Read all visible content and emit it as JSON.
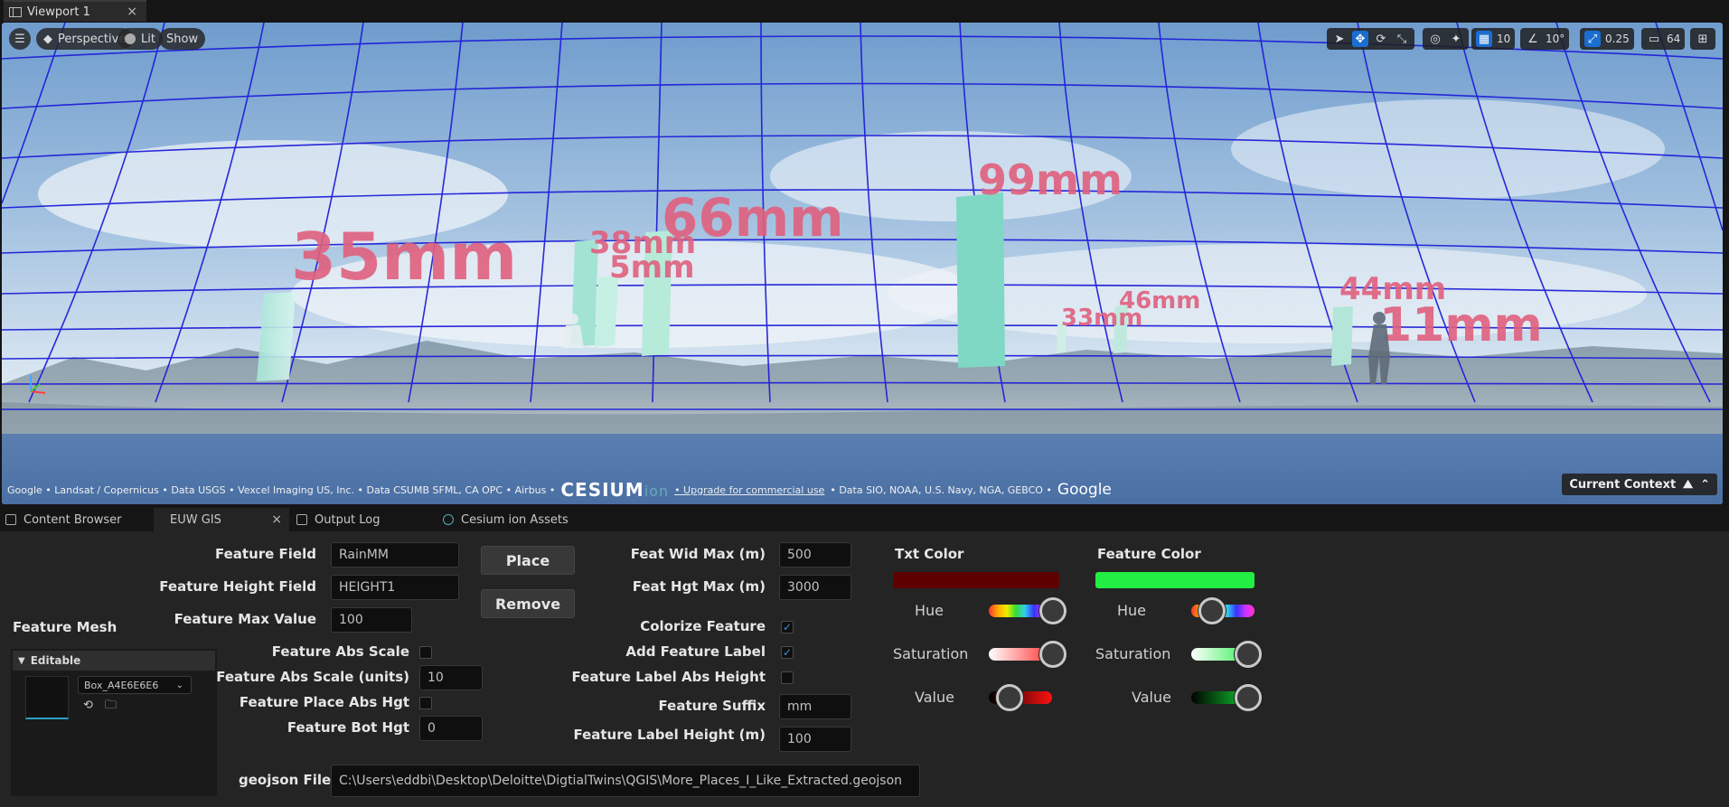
{
  "window": {
    "tab_label": "Viewport 1",
    "close": "×"
  },
  "viewport": {
    "menu_icon": "hamburger-icon",
    "perspective_label": "Perspective",
    "lit_label": "Lit",
    "show_label": "Show",
    "grid_snap_value": "10",
    "rotation_snap_value": "10°",
    "scale_snap_value": "0.25",
    "camera_speed_value": "64",
    "labels": [
      "35mm",
      "38mm",
      "5mm",
      "66mm",
      "99mm",
      "33mm",
      "46mm",
      "44mm",
      "11mm"
    ],
    "attribution_left": "Google • Landsat / Copernicus • Data USGS • Vexcel Imaging US, Inc. • Data CSUMB SFML, CA OPC • Airbus •",
    "cesium_logo": "CESIUM",
    "cesium_ion": "ion",
    "upgrade_link": "• Upgrade for commercial use",
    "attribution_right": "• Data SIO, NOAA, U.S. Navy, NGA, GEBCO •",
    "google_logo": "Google",
    "current_context": "Current Context"
  },
  "bottom_tabs": [
    "Content Browser",
    "EUW GIS",
    "Output Log",
    "Cesium ion Assets"
  ],
  "form": {
    "feature_field_label": "Feature Field",
    "feature_field_value": "RainMM",
    "feature_height_field_label": "Feature Height Field",
    "feature_height_field_value": "HEIGHT1",
    "feature_max_value_label": "Feature Max Value",
    "feature_max_value": "100",
    "place_button": "Place",
    "remove_button": "Remove",
    "feature_abs_scale_label": "Feature Abs Scale",
    "feature_abs_scale_units_label": "Feature Abs Scale (units)",
    "feature_abs_scale_units_value": "10",
    "feature_place_abs_hgt_label": "Feature Place Abs Hgt",
    "feature_bot_hgt_label": "Feature Bot Hgt",
    "feature_bot_hgt_value": "0",
    "feat_wid_max_label": "Feat Wid Max (m)",
    "feat_wid_max_value": "500",
    "feat_hgt_max_label": "Feat Hgt Max (m)",
    "feat_hgt_max_value": "3000",
    "colorize_feature_label": "Colorize Feature",
    "add_feature_label_label": "Add Feature Label",
    "feature_label_abs_height_label": "Feature Label Abs Height",
    "feature_suffix_label": "Feature Suffix",
    "feature_suffix_value": "mm",
    "feature_label_height_label": "Feature Label Height (m)",
    "feature_label_height_value": "100",
    "geojson_label": "geojson File",
    "geojson_value": "C:\\Users\\eddbi\\Desktop\\Deloitte\\DigtialTwins\\QGIS\\More_Places_I_Like_Extracted.geojson"
  },
  "colors": {
    "txt_color_label": "Txt Color",
    "txt_color_value": "#5e0000",
    "feature_color_label": "Feature Color",
    "feature_color_value": "#22ee44",
    "hue_label": "Hue",
    "saturation_label": "Saturation",
    "value_label": "Value"
  },
  "mesh": {
    "title": "Feature Mesh",
    "category": "Editable",
    "asset_name": "Box_A4E6E6E6"
  }
}
